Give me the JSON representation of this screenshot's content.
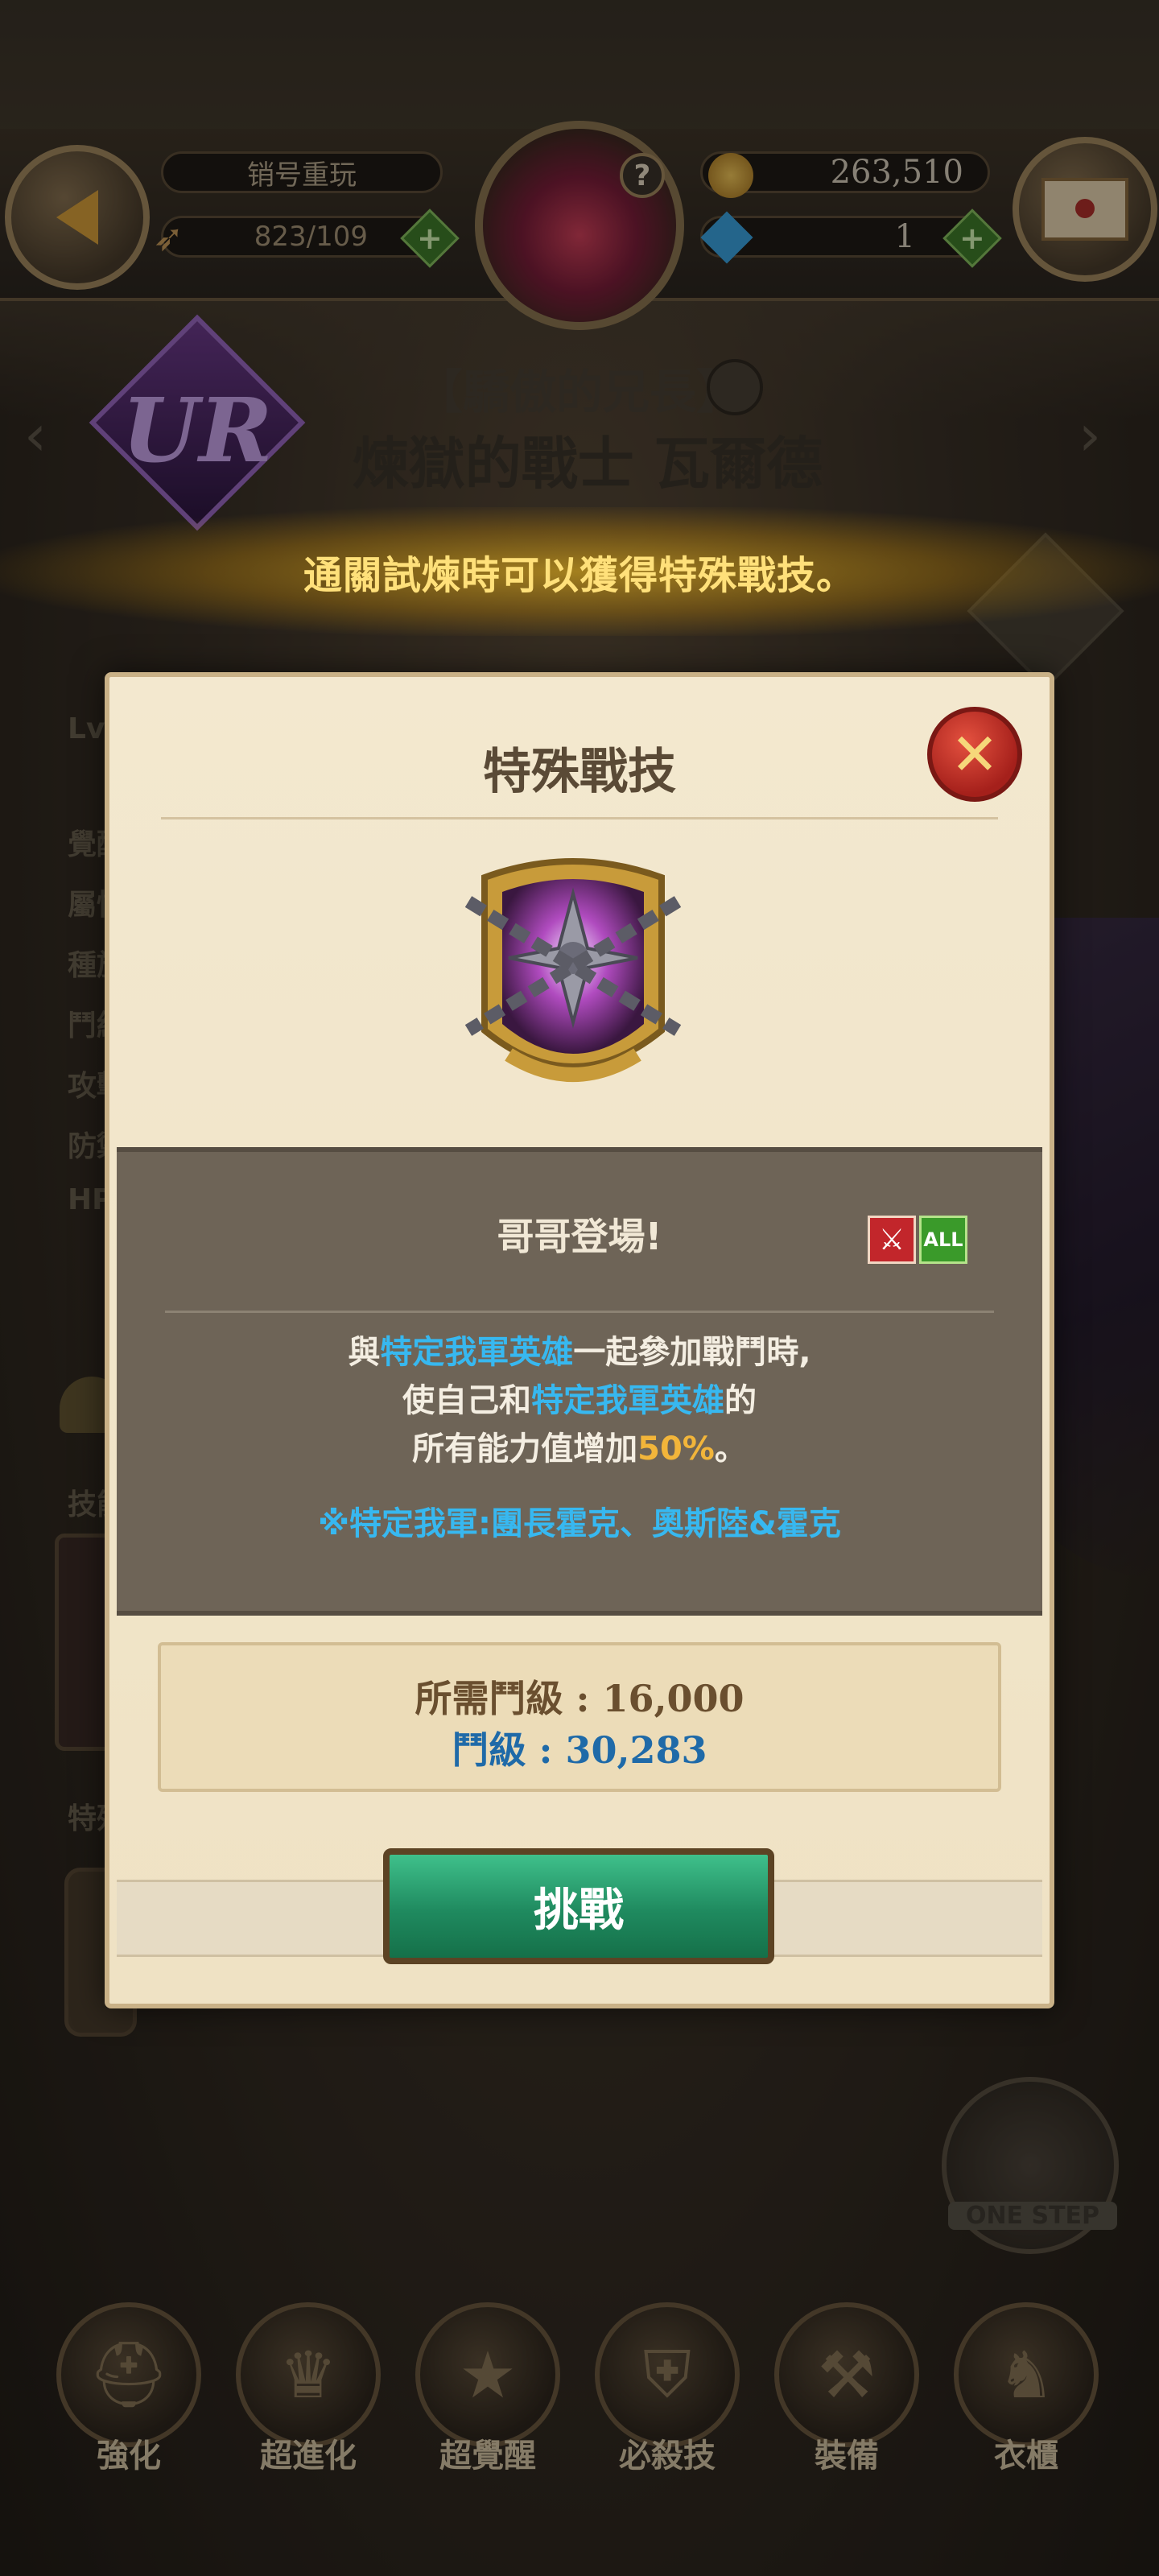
{
  "hud": {
    "name_label": "销号重玩",
    "stamina": "823/109",
    "gold": "263,510",
    "gems": "1",
    "plus": "+",
    "help": "?"
  },
  "hero": {
    "rank": "UR",
    "subtitle": "【驕傲的兄長】",
    "name": "煉獄的戰士 瓦爾德"
  },
  "banner": "通關試煉時可以獲得特殊戰技。",
  "side_stats": [
    "Lv",
    "覺醒",
    "屬性",
    "種族",
    "鬥級",
    "攻擊",
    "防禦",
    "HP",
    "技能",
    "特殊"
  ],
  "modal": {
    "title": "特殊戰技",
    "close": "✕",
    "skill_name": "哥哥登場!",
    "attr_icon": "sword-attribute-icon",
    "all_label": "ALL",
    "desc": {
      "p1": "與",
      "hl1": "特定我軍英雄",
      "p2": "一起參加戰鬥時,",
      "p3": "使自己和",
      "hl2": "特定我軍英雄",
      "p4": "的",
      "p5": "所有能力值增加",
      "pct": "50%",
      "p6": "。"
    },
    "note": "※特定我軍:團長霍克、奧斯陸&霍克",
    "required_level": "所需鬥級 : 16,000",
    "current_level": "鬥級 : 30,283",
    "challenge_label": "挑戰"
  },
  "bottom_nav": [
    {
      "label": "強化",
      "icon": "helmet-upgrade-icon"
    },
    {
      "label": "超進化",
      "icon": "evolve-icon"
    },
    {
      "label": "超覺醒",
      "icon": "star-awaken-icon"
    },
    {
      "label": "必殺技",
      "icon": "shield-skill-icon"
    },
    {
      "label": "裝備",
      "icon": "equipment-icon"
    },
    {
      "label": "衣櫃",
      "icon": "wardrobe-icon"
    }
  ],
  "onestep_label": "ONE STEP",
  "colors": {
    "accent_gold": "#ffe07a",
    "highlight_blue": "#37b8f0",
    "highlight_orange": "#f2b53a",
    "button_green": "#1f8a5f",
    "close_red": "#a5201b"
  }
}
